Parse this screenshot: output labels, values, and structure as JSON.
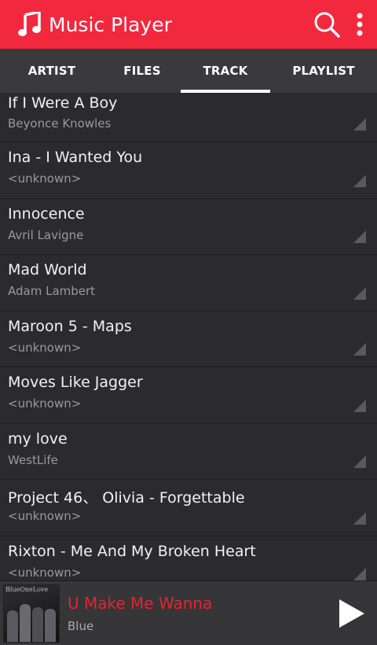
{
  "appbar": {
    "title": "Music Player",
    "color": "#f2283f"
  },
  "tabs": [
    {
      "label": "ARTIST"
    },
    {
      "label": "FILES"
    },
    {
      "label": "TRACK",
      "active": true
    },
    {
      "label": "PLAYLIST"
    }
  ],
  "tracks": [
    {
      "title": "If I Were A Boy",
      "artist": "Beyonce Knowles"
    },
    {
      "title": "Ina - I Wanted You",
      "artist": "<unknown>"
    },
    {
      "title": "Innocence",
      "artist": "Avril Lavigne"
    },
    {
      "title": "Mad World",
      "artist": "Adam Lambert"
    },
    {
      "title": "Maroon 5 - Maps",
      "artist": "<unknown>"
    },
    {
      "title": "Moves Like Jagger",
      "artist": "<unknown>"
    },
    {
      "title": "my love",
      "artist": "WestLife"
    },
    {
      "title": "Project 46、 Olivia - Forgettable",
      "artist": "<unknown>"
    },
    {
      "title": "Rixton - Me And My Broken Heart",
      "artist": "<unknown>"
    }
  ],
  "now_playing": {
    "title": "U Make Me Wanna",
    "artist": "Blue",
    "album_art_text": "BlueOneLove",
    "title_color": "#e5242e"
  },
  "icons": {
    "app": "music-note-icon",
    "search": "search-icon",
    "more": "more-vert-icon",
    "row_menu": "corner-triangle-icon",
    "play": "play-icon"
  }
}
